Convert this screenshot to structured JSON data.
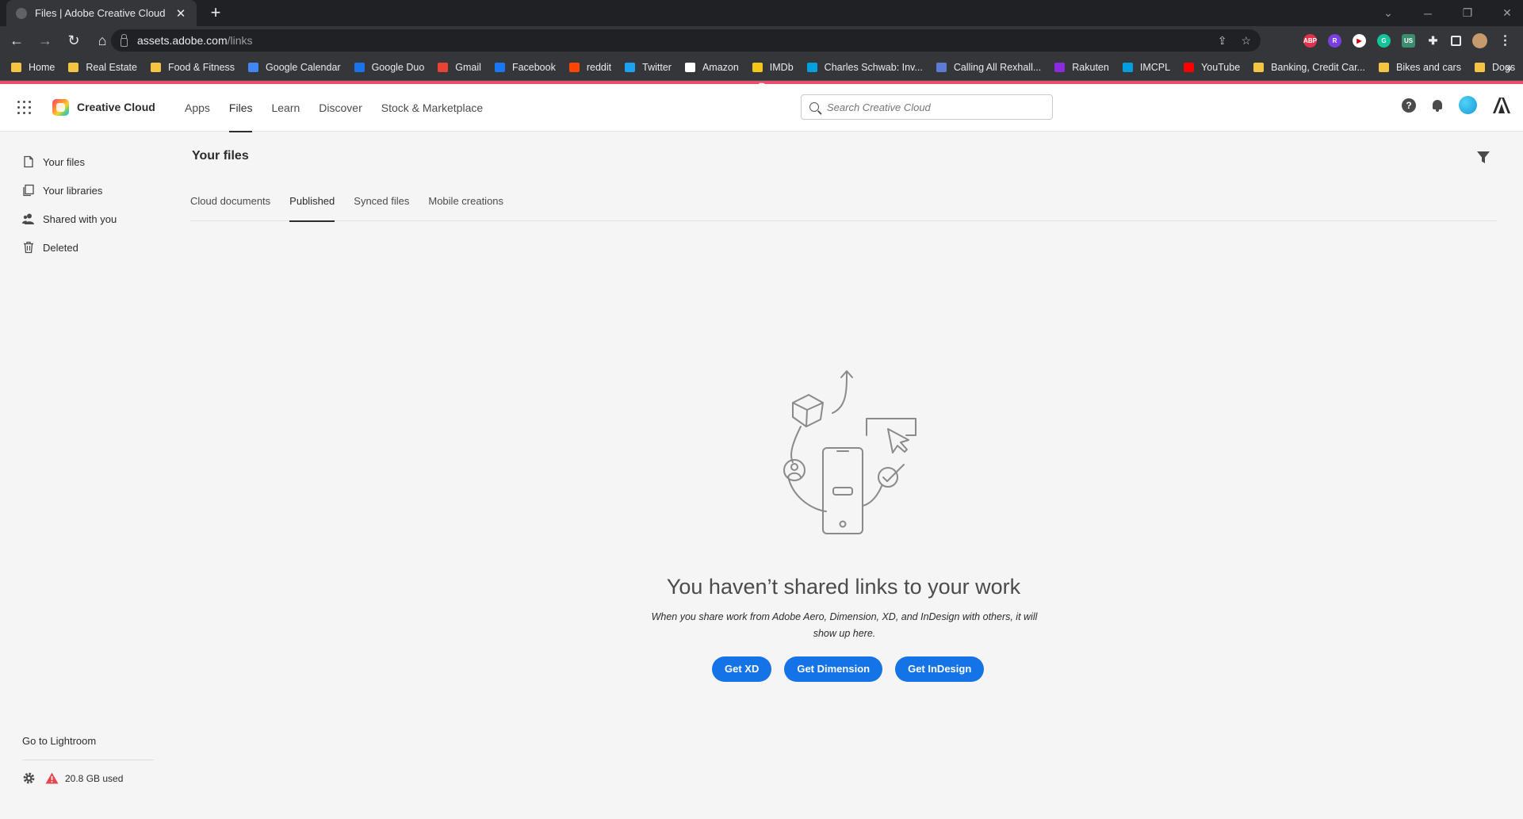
{
  "browser": {
    "tab_title": "Files | Adobe Creative Cloud",
    "url_host": "assets.adobe.com",
    "url_path": "/links",
    "bookmarks": [
      {
        "label": "Home",
        "color": "#f4c542"
      },
      {
        "label": "Real Estate",
        "color": "#f4c542"
      },
      {
        "label": "Food & Fitness",
        "color": "#f4c542"
      },
      {
        "label": "Google Calendar",
        "color": "#4285f4"
      },
      {
        "label": "Google Duo",
        "color": "#1a73e8"
      },
      {
        "label": "Gmail",
        "color": "#ea4335"
      },
      {
        "label": "Facebook",
        "color": "#1877f2"
      },
      {
        "label": "reddit",
        "color": "#ff4500"
      },
      {
        "label": "Twitter",
        "color": "#1da1f2"
      },
      {
        "label": "Amazon",
        "color": "#ffffff"
      },
      {
        "label": "IMDb",
        "color": "#f5c518"
      },
      {
        "label": "Charles Schwab: Inv...",
        "color": "#00a0df"
      },
      {
        "label": "Calling All Rexhall...",
        "color": "#5b7bd5"
      },
      {
        "label": "Rakuten",
        "color": "#8a2be2"
      },
      {
        "label": "IMCPL",
        "color": "#00a0df"
      },
      {
        "label": "YouTube",
        "color": "#ff0000"
      },
      {
        "label": "Banking, Credit Car...",
        "color": "#f4c542"
      },
      {
        "label": "Bikes and cars",
        "color": "#f4c542"
      },
      {
        "label": "Dogs",
        "color": "#f4c542"
      }
    ]
  },
  "header": {
    "brand": "Creative Cloud",
    "nav": [
      "Apps",
      "Files",
      "Learn",
      "Discover",
      "Stock & Marketplace"
    ],
    "active_nav": "Files",
    "search_placeholder": "Search Creative Cloud",
    "help_glyph": "?"
  },
  "sidebar": {
    "items": [
      {
        "label": "Your files",
        "icon": "file-icon"
      },
      {
        "label": "Your libraries",
        "icon": "libraries-icon"
      },
      {
        "label": "Shared with you",
        "icon": "people-icon"
      },
      {
        "label": "Deleted",
        "icon": "trash-icon"
      }
    ],
    "footer_link": "Go to Lightroom",
    "storage": "20.8 GB used"
  },
  "main": {
    "title": "Your files",
    "tabs": [
      "Cloud documents",
      "Published",
      "Synced files",
      "Mobile creations"
    ],
    "active_tab": "Published",
    "empty_title": "You haven’t shared links to your work",
    "empty_desc": "When you share work from Adobe Aero, Dimension, XD, and InDesign with others, it will show up here.",
    "buttons": [
      "Get XD",
      "Get Dimension",
      "Get InDesign"
    ]
  },
  "colors": {
    "accent": "#1473e6",
    "brand_bar": "#e94e6b"
  }
}
